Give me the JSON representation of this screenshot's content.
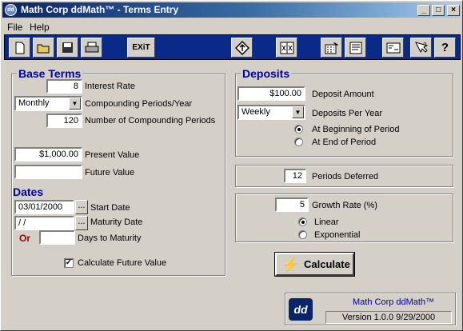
{
  "window": {
    "title": "Math Corp ddMath™ - Terms Entry",
    "icon": "dd",
    "controls": [
      "_",
      "□",
      "×"
    ]
  },
  "menu": [
    "File",
    "Help"
  ],
  "toolbar": {
    "exit_label": "EXiT"
  },
  "base_terms": {
    "title": "Base Terms",
    "interest_rate": {
      "value": "8",
      "label": "Interest Rate"
    },
    "compounding": {
      "value": "Monthly",
      "label": "Compounding Periods/Year"
    },
    "num_periods": {
      "value": "120",
      "label": "Number of Compounding Periods"
    },
    "present_value": {
      "value": "$1,000.00",
      "label": "Present Value"
    },
    "future_value": {
      "value": "",
      "label": "Future Value"
    }
  },
  "dates": {
    "title": "Dates",
    "start_date": {
      "value": "03/01/2000",
      "label": "Start Date"
    },
    "maturity_date": {
      "value": " /  /",
      "label": "Maturity Date"
    },
    "or_label": "Or",
    "days_to_maturity": {
      "value": "",
      "label": "Days to Maturity"
    },
    "calc_future_value": {
      "label": "Calculate Future Value",
      "checked": true
    }
  },
  "deposits": {
    "title": "Deposits",
    "amount": {
      "value": "$100.00",
      "label": "Deposit Amount"
    },
    "per_year": {
      "value": "Weekly",
      "label": "Deposits Per Year"
    },
    "timing": [
      {
        "label": "At Beginning of Period",
        "selected": true
      },
      {
        "label": "At End of Period",
        "selected": false
      }
    ]
  },
  "deferred": {
    "value": "12",
    "label": "Periods Deferred"
  },
  "growth": {
    "value": "5",
    "label": "Growth Rate (%)",
    "options": [
      {
        "label": "Linear",
        "selected": true
      },
      {
        "label": "Exponential",
        "selected": false
      }
    ]
  },
  "calculate_label": "Calculate",
  "about": {
    "logo": "dd",
    "product": "Math Corp ddMath™",
    "version": "Version 1.0.0  9/29/2000"
  },
  "colors": {
    "accent": "#0000a0",
    "or_label": "#a00000",
    "toolbar": "#0a2a8a"
  }
}
